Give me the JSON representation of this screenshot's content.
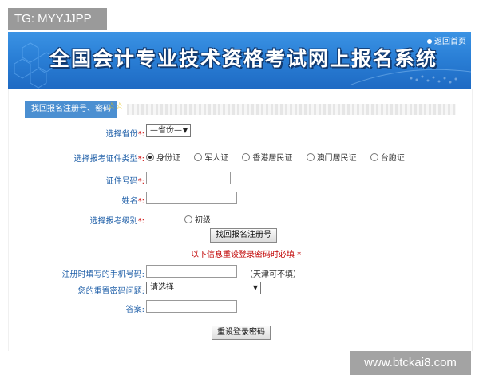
{
  "watermarks": {
    "top_left": "TG: MYYJJPP",
    "bottom_right": "www.btckai8.com"
  },
  "banner": {
    "title": "全国会计专业技术资格考试网上报名系统",
    "home_link": "返回首页"
  },
  "tab": {
    "label": "找回报名注册号、密码",
    "stars": "☆☆"
  },
  "form": {
    "province": {
      "label": "选择省份",
      "required": "*:",
      "value": "—省份—"
    },
    "id_type": {
      "label": "选择报考证件类型",
      "required": "*:",
      "options": [
        "身份证",
        "军人证",
        "香港居民证",
        "澳门居民证",
        "台胞证"
      ],
      "selected_index": 0
    },
    "id_number": {
      "label": "证件号码",
      "required": "*:",
      "value": ""
    },
    "name": {
      "label": "姓名",
      "required": "*:",
      "value": ""
    },
    "level": {
      "label": "选择报考级别",
      "required": "*:",
      "option": "初级"
    },
    "retrieve_button": "找回报名注册号",
    "notice": "以下信息重设登录密码时必填 *",
    "phone": {
      "label": "注册时填写的手机号码:",
      "value": "",
      "hint": "（天津可不填）"
    },
    "question": {
      "label": "您的重置密码问题:",
      "value": "请选择"
    },
    "answer": {
      "label": "答案:",
      "value": ""
    },
    "reset_button": "重设登录密码"
  }
}
